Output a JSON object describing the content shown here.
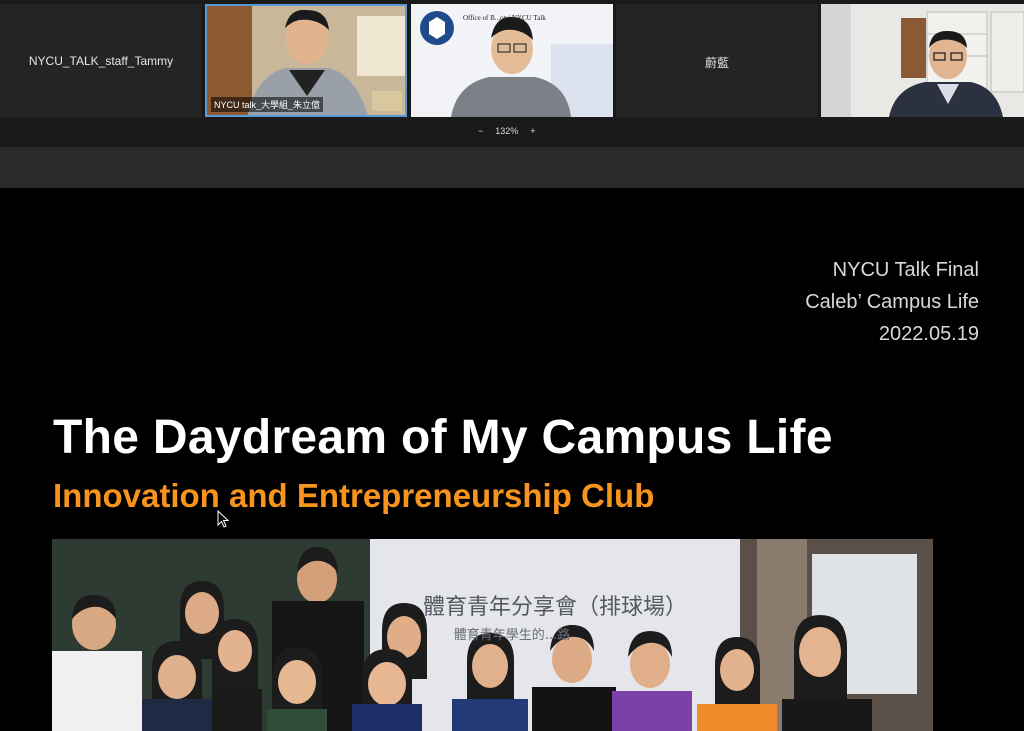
{
  "participants": [
    {
      "name": "NYCU_TALK_staff_Tammy",
      "video": false
    },
    {
      "name": "NYCU talk_大學組_朱立億",
      "video": true,
      "active": true
    },
    {
      "name": "",
      "video": true,
      "slide_text": "Office of B...on | NYCU Talk"
    },
    {
      "name": "蔚藍",
      "video": false
    },
    {
      "name": "",
      "video": true
    }
  ],
  "zoom": {
    "minus": "−",
    "level": "132%",
    "plus": "+"
  },
  "slide": {
    "meta_lines": [
      "NYCU Talk Final",
      "Caleb’ Campus Life",
      "2022.05.19"
    ],
    "title": "The Daydream of My Campus Life",
    "subtitle": "Innovation and Entrepreneurship Club",
    "photo_screen_text": "體育青年分享會（排球場）",
    "photo_screen_subtext": "體育青年學生的...路"
  },
  "colors": {
    "accent": "#f7941d",
    "active_border": "#5b9bd5"
  }
}
